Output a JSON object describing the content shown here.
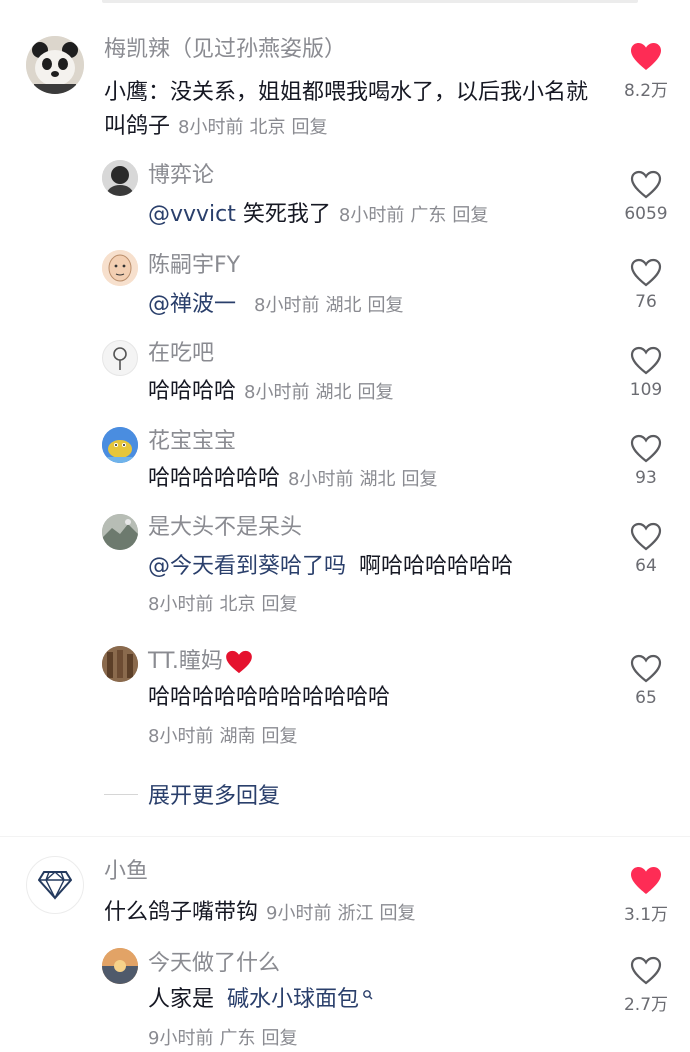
{
  "comments": [
    {
      "user": "梅凯辣（见过孙燕姿版）",
      "text": "小鹰：没关系，姐姐都喂我喝水了，以后我小名就叫鸽子",
      "time": "8小时前",
      "location": "北京",
      "reply_label": "回复",
      "likes": "8.2万",
      "liked": true,
      "avatar_icon": "panda-avatar-icon"
    },
    {
      "user": "小鱼",
      "text": "什么鸽子嘴带钩",
      "time": "9小时前",
      "location": "浙江",
      "reply_label": "回复",
      "likes": "3.1万",
      "liked": true,
      "avatar_icon": "diamond-avatar-icon"
    }
  ],
  "replies": [
    {
      "user": "博弈论",
      "mention": "@vvvict",
      "text": "笑死我了",
      "time": "8小时前",
      "location": "广东",
      "reply_label": "回复",
      "likes": "6059"
    },
    {
      "user": "陈嗣宇FY",
      "mention": "@禅波一",
      "text": "",
      "time": "8小时前",
      "location": "湖北",
      "reply_label": "回复",
      "likes": "76"
    },
    {
      "user": "在吃吧",
      "text": "哈哈哈哈",
      "time": "8小时前",
      "location": "湖北",
      "reply_label": "回复",
      "likes": "109"
    },
    {
      "user": "花宝宝宝",
      "text": "哈哈哈哈哈哈",
      "time": "8小时前",
      "location": "湖北",
      "reply_label": "回复",
      "likes": "93"
    },
    {
      "user": "是大头不是呆头",
      "mention": "@今天看到葵哈了吗",
      "text": "啊哈哈哈哈哈哈",
      "time": "8小时前",
      "location": "北京",
      "reply_label": "回复",
      "likes": "64"
    },
    {
      "user": "TT.瞳妈",
      "user_emoji": "red-heart-icon",
      "text": "哈哈哈哈哈哈哈哈哈哈哈",
      "time": "8小时前",
      "location": "湖南",
      "reply_label": "回复",
      "likes": "65"
    },
    {
      "user": "今天做了什么",
      "text_prefix": "人家是",
      "link_text": "碱水小球面包",
      "link_icon": "search-icon",
      "time": "9小时前",
      "location": "广东",
      "reply_label": "回复",
      "likes": "2.7万"
    }
  ],
  "expand_label": "展开更多回复",
  "colors": {
    "liked_heart": "#fe2c55",
    "link": "#2a3f6b",
    "muted": "#8a8b91"
  }
}
